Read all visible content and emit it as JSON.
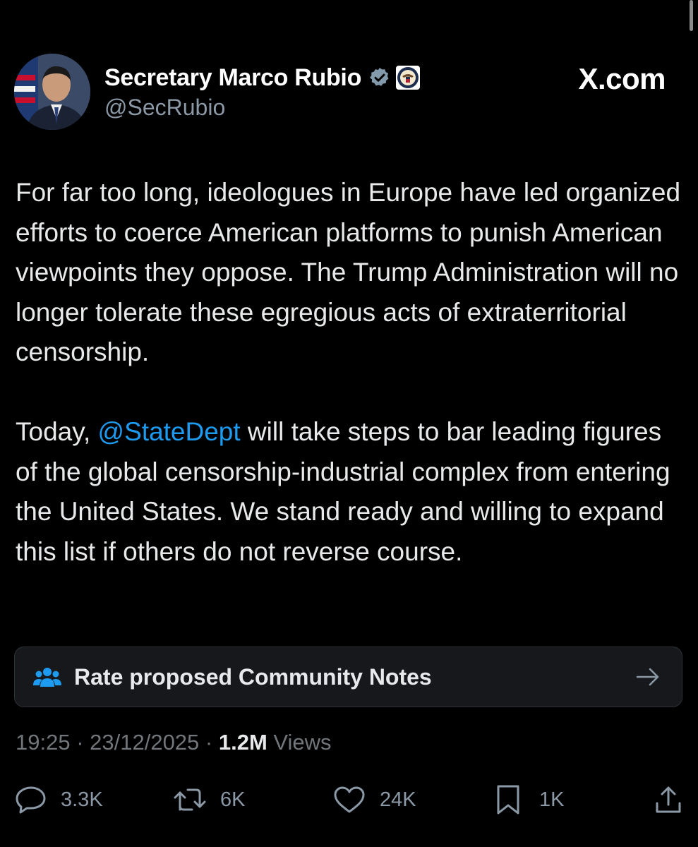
{
  "author": {
    "display_name": "Secretary Marco Rubio",
    "handle": "@SecRubio",
    "verified_badge_icon": "verified-badge-icon",
    "affiliation_icon": "state-department-seal-icon"
  },
  "watermark": "X.com",
  "tweet": {
    "paragraph1": "For far too long, ideologues in Europe have led organized efforts to coerce American platforms to punish American viewpoints they oppose. The Trump Administration will no longer tolerate these egregious acts of extraterritorial censorship.",
    "paragraph2_before": "Today, ",
    "mention": "@StateDept",
    "paragraph2_after": " will take steps to bar leading figures of the global censorship-industrial complex from entering the United States. We stand ready and willing to expand this list if others do not reverse course."
  },
  "community_notes": {
    "label": "Rate proposed Community Notes",
    "icon": "people-icon",
    "arrow_icon": "arrow-right-icon"
  },
  "meta": {
    "time": "19:25",
    "separator": " · ",
    "date": "23/12/2025",
    "views_count": "1.2M",
    "views_label": " Views"
  },
  "actions": {
    "replies": "3.3K",
    "reposts": "6K",
    "likes": "24K",
    "bookmarks": "1K"
  },
  "colors": {
    "background": "#000000",
    "text": "#e7e9ea",
    "secondary": "#71767b",
    "link": "#1d9bf0",
    "verified": "#829aab"
  }
}
